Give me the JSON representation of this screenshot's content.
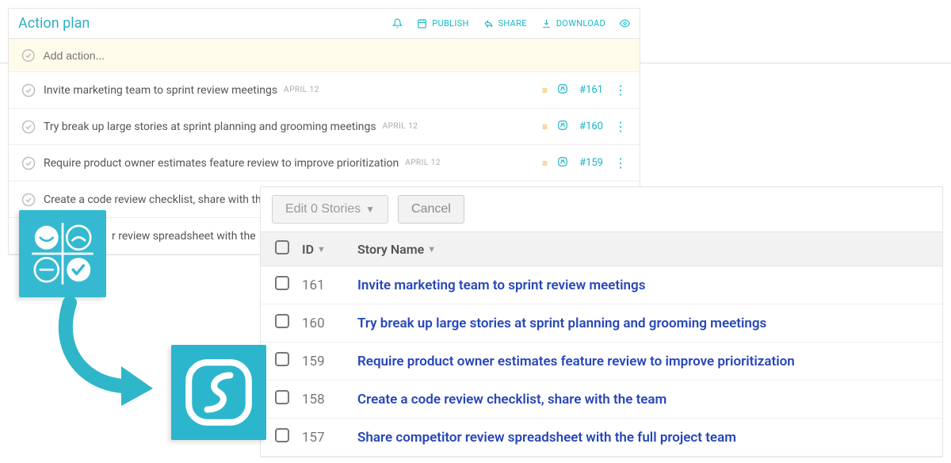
{
  "colors": {
    "teal": "#1db3c4",
    "orange": "#f5a623",
    "link": "#2746b8"
  },
  "actionPlan": {
    "title": "Action plan",
    "headerActions": {
      "publish": "PUBLISH",
      "share": "SHARE",
      "download": "DOWNLOAD"
    },
    "addPlaceholder": "Add action...",
    "rows": [
      {
        "text": "Invite marketing team to sprint review meetings",
        "date": "APRIL 12",
        "issue": "#161"
      },
      {
        "text": "Try break up large stories at sprint planning and grooming meetings",
        "date": "APRIL 12",
        "issue": "#160"
      },
      {
        "text": "Require product owner estimates feature review to improve prioritization",
        "date": "APRIL 12",
        "issue": "#159"
      },
      {
        "text": "Create a code review checklist, share with the",
        "date": "",
        "issue": ""
      },
      {
        "text": "r review spreadsheet with the",
        "date": "",
        "issue": ""
      }
    ]
  },
  "storyPanel": {
    "editBtn": "Edit 0 Stories",
    "cancelBtn": "Cancel",
    "columns": {
      "id": "ID",
      "name": "Story Name"
    },
    "rows": [
      {
        "id": "161",
        "name": "Invite marketing team to sprint review meetings"
      },
      {
        "id": "160",
        "name": "Try break up large stories at sprint planning and grooming meetings"
      },
      {
        "id": "159",
        "name": "Require product owner estimates feature review to improve prioritization"
      },
      {
        "id": "158",
        "name": "Create a code review checklist, share with the team"
      },
      {
        "id": "157",
        "name": "Share competitor review spreadsheet with the full project team"
      }
    ]
  }
}
